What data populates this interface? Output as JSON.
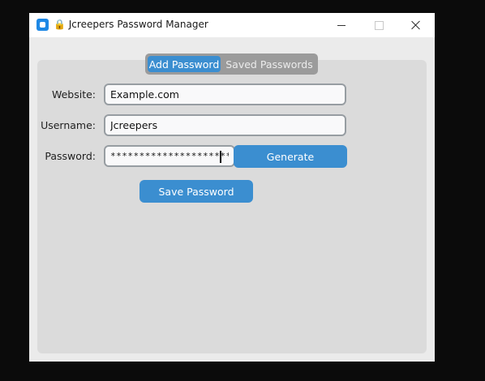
{
  "window": {
    "title": "🔒 Jcreepers Password Manager",
    "icon": "app-icon"
  },
  "tabs": [
    {
      "label": "Add Password",
      "selected": true
    },
    {
      "label": "Saved Passwords",
      "selected": false
    }
  ],
  "form": {
    "website_label": "Website:",
    "website_value": "Example.com",
    "username_label": "Username:",
    "username_value": "Jcreepers",
    "password_label": "Password:",
    "password_value": "************************",
    "generate_label": "Generate",
    "save_label": "Save Password"
  },
  "colors": {
    "accent": "#3b8ed0",
    "panel": "#dbdbdb",
    "window": "#ebebeb"
  }
}
